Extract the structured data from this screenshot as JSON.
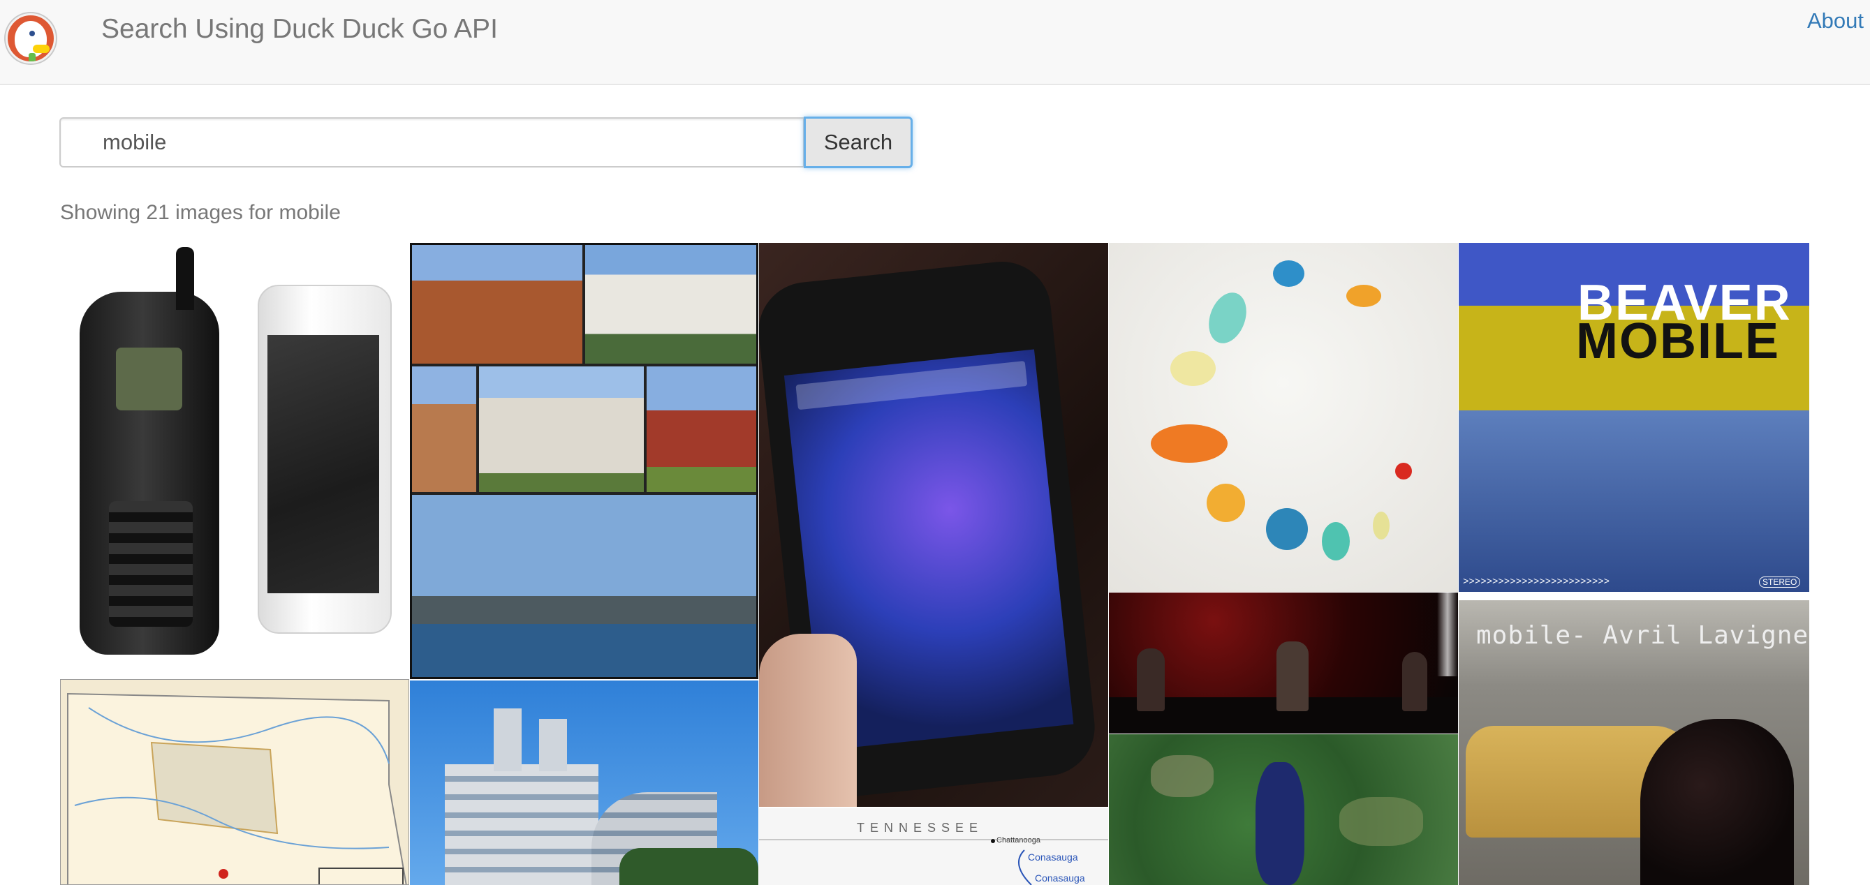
{
  "navbar": {
    "brand": "Search Using Duck Duck Go API",
    "about_link": "About",
    "logo": "duckduckgo-logo"
  },
  "search": {
    "query": "mobile",
    "button_label": "Search"
  },
  "results": {
    "summary": "Showing 21 images for mobile",
    "tiles": {
      "beaver_mobile": {
        "line1": "BEAVER",
        "line2": "MOBILE",
        "arrows": ">>>>>>>>>>>>>>>>>>>>>>>>>",
        "badge": "STEREO"
      },
      "avril": {
        "title": "mobile- Avril Lavigne"
      },
      "tn_map": {
        "state": "TENNESSEE",
        "city1": "Chattanooga",
        "city2": "Conasauga",
        "city3": "Conasauga"
      }
    }
  },
  "colors": {
    "link": "#337ab7",
    "navbar_bg": "#f8f8f8",
    "focus_ring": "#66afe9"
  }
}
